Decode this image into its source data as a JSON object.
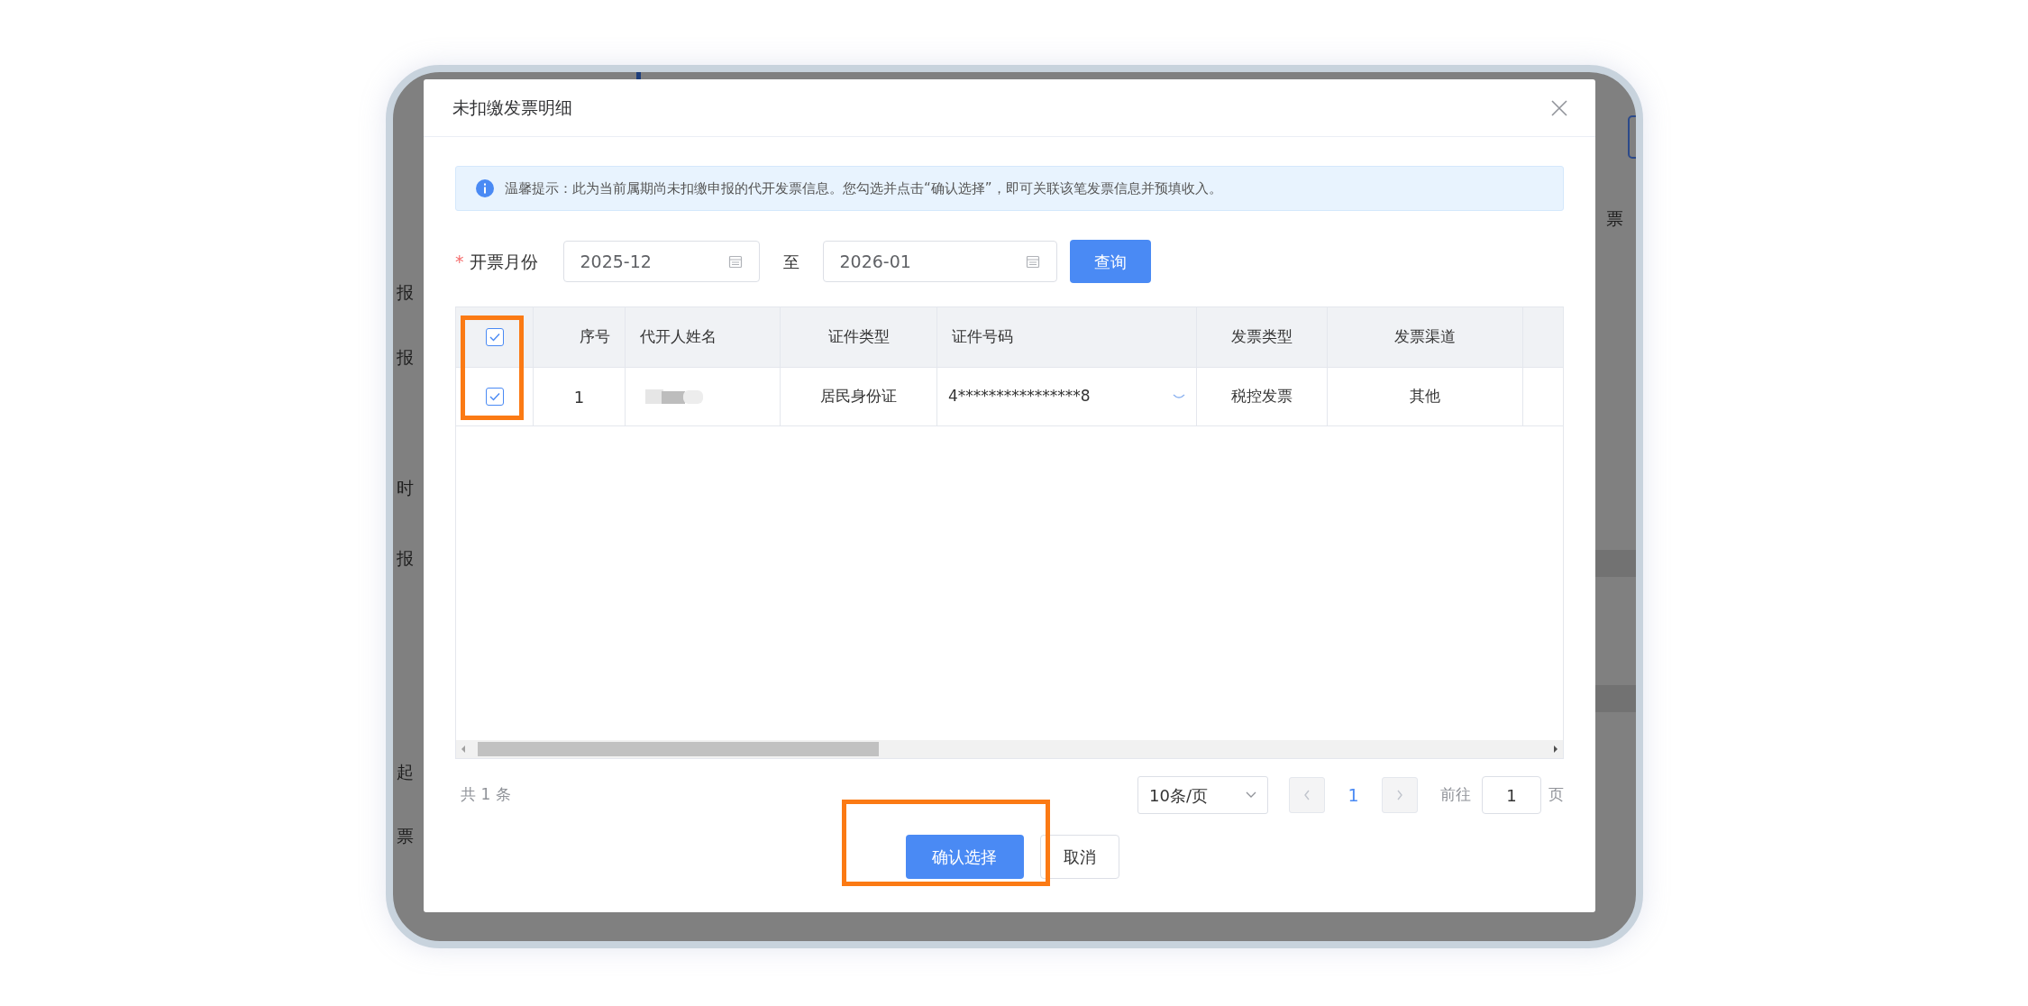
{
  "background": {
    "left_labels": [
      "报",
      "报",
      "时",
      "报",
      "起",
      "票"
    ],
    "right_column": "票"
  },
  "dialog": {
    "title": "未扣缴发票明细",
    "tip": "温馨提示：此为当前属期尚未扣缴申报的代开发票信息。您勾选并点击“确认选择”，即可关联该笔发票信息并预填收入。",
    "filter": {
      "required_mark": "*",
      "label": "开票月份",
      "start": "2025-12",
      "separator": "至",
      "end": "2026-01",
      "query_button": "查询"
    },
    "table": {
      "select_all_checked": true,
      "columns": [
        "序号",
        "代开人姓名",
        "证件类型",
        "证件号码",
        "发票类型",
        "发票渠道"
      ],
      "rows": [
        {
          "checked": true,
          "index": "1",
          "name_redacted": true,
          "id_type": "居民身份证",
          "id_number": "4****************8",
          "invoice_type": "税控发票",
          "channel": "其他"
        }
      ]
    },
    "pagination": {
      "total": "共 1 条",
      "page_size": "10条/页",
      "pages": [
        {
          "label": "1",
          "selected": true
        }
      ],
      "goto_label": "前往",
      "goto_value": "1",
      "goto_suffix": "页"
    },
    "buttons": {
      "confirm": "确认选择",
      "cancel": "取消"
    }
  }
}
